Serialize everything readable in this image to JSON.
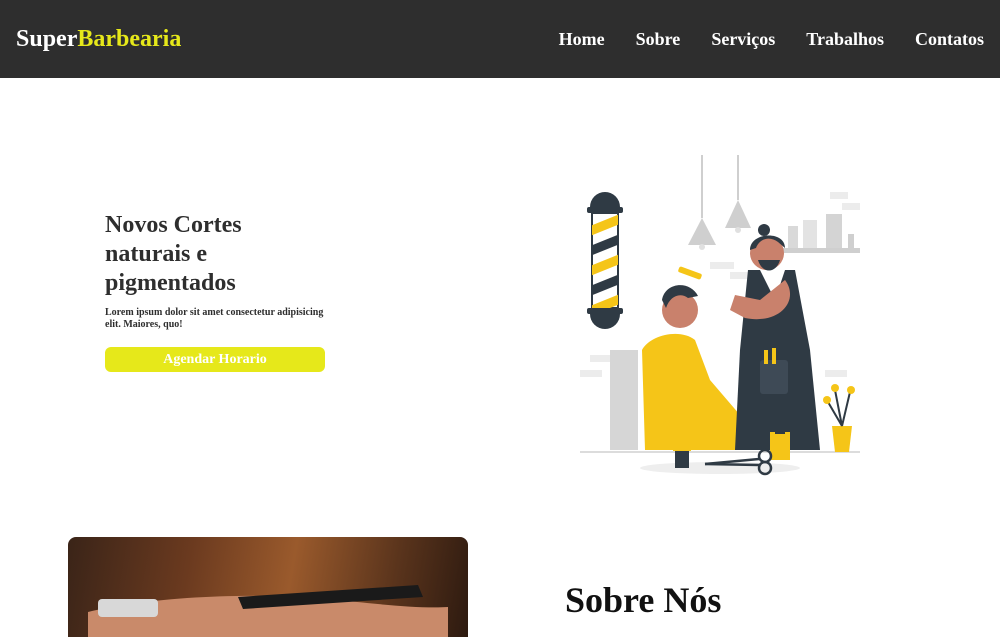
{
  "navbar": {
    "logo_part1": "Super",
    "logo_part2": "Barbearia",
    "links": [
      "Home",
      "Sobre",
      "Serviços",
      "Trabalhos",
      "Contatos"
    ]
  },
  "hero": {
    "title": "Novos Cortes naturais e pigmentados",
    "text": "Lorem ipsum dolor sit amet consectetur adipisicing elit. Maiores, quo!",
    "button_label": "Agendar Horario"
  },
  "about": {
    "title": "Sobre Nós"
  },
  "colors": {
    "navbar_bg": "#2e2e2e",
    "accent": "#e6e81a",
    "illustration_yellow": "#f5c518",
    "illustration_dark": "#2f3a44"
  },
  "icons": [
    "barber-pole-icon",
    "hanging-lamp-icon",
    "scissors-icon",
    "plant-icon"
  ]
}
